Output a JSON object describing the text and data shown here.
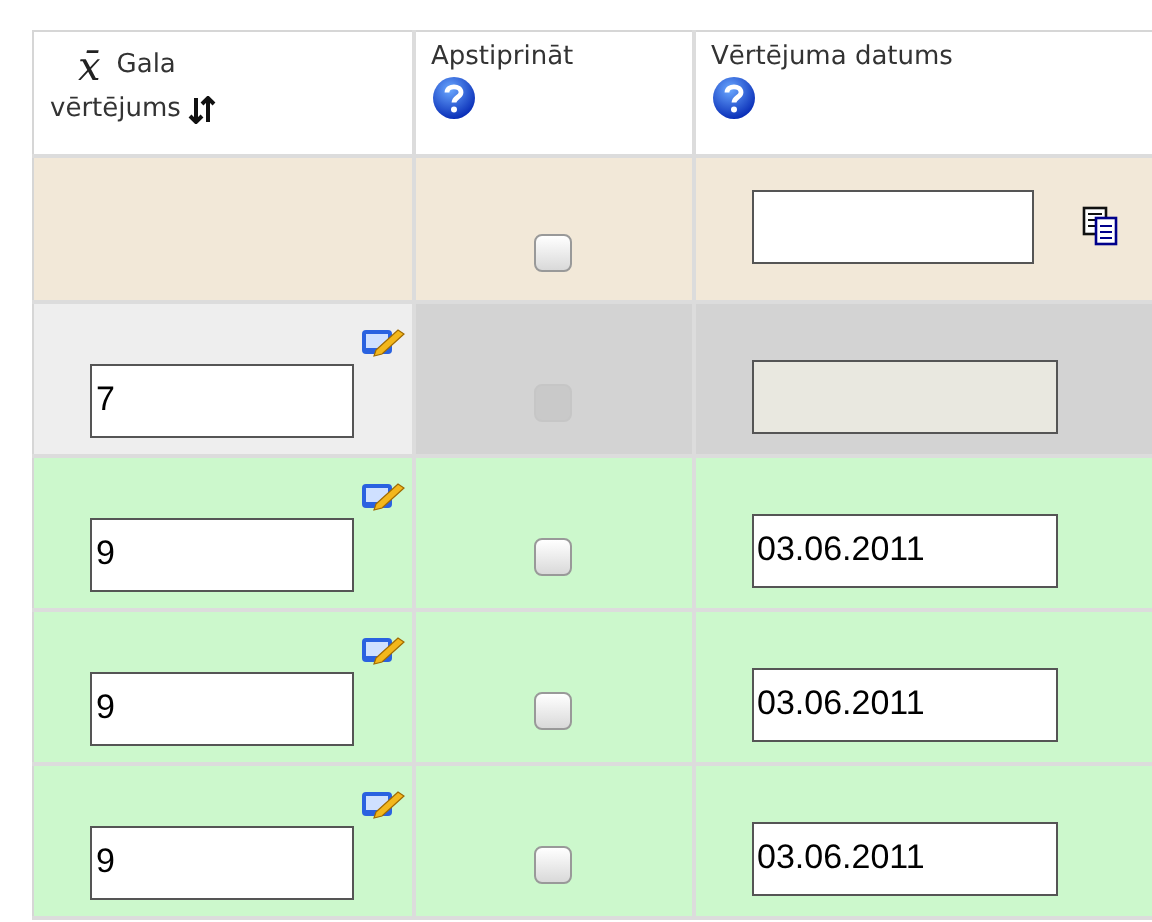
{
  "columns": [
    {
      "symbol": "x̄",
      "label": "Gala",
      "label_line2": "vērtējums",
      "sortable": true,
      "help": false
    },
    {
      "label": "Apstiprināt",
      "help": true
    },
    {
      "label": "Vērtējuma datums",
      "help": true
    }
  ],
  "rows": [
    {
      "kind": "new",
      "approved": false,
      "disabled": false,
      "date": ""
    },
    {
      "kind": "locked",
      "grade": "7",
      "approved": false,
      "disabled": true
    },
    {
      "kind": "ok",
      "grade": "9",
      "approved": false,
      "disabled": false,
      "date": "03.06.2011"
    },
    {
      "kind": "ok",
      "grade": "9",
      "approved": false,
      "disabled": false,
      "date": "03.06.2011"
    },
    {
      "kind": "ok",
      "grade": "9",
      "approved": false,
      "disabled": false,
      "date": "03.06.2011"
    }
  ]
}
